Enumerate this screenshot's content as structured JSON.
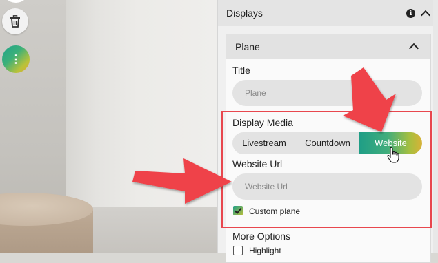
{
  "displays": {
    "title": "Displays"
  },
  "plane": {
    "title": "Plane",
    "title_label": "Title",
    "title_placeholder": "Plane",
    "display_media_label": "Display Media",
    "media_options": [
      "Livestream",
      "Countdown",
      "Website"
    ],
    "selected_media": "Website",
    "website_url_label": "Website Url",
    "website_url_placeholder": "Website Url",
    "custom_plane_label": "Custom plane",
    "custom_plane_checked": true,
    "more_options_label": "More Options",
    "highlight_label": "Highlight",
    "highlight_checked": false
  },
  "toolbar": {
    "more_glyph": "⋮"
  },
  "colors": {
    "accent_start": "#1f9e86",
    "accent_end": "#d9b237",
    "annotation_red": "#e8474e"
  },
  "icons": {
    "trash": "trash-icon",
    "info": "info-icon",
    "more": "more-vertical-icon",
    "collapse": "chevron-up-icon",
    "cursor": "hand-pointer-icon"
  }
}
